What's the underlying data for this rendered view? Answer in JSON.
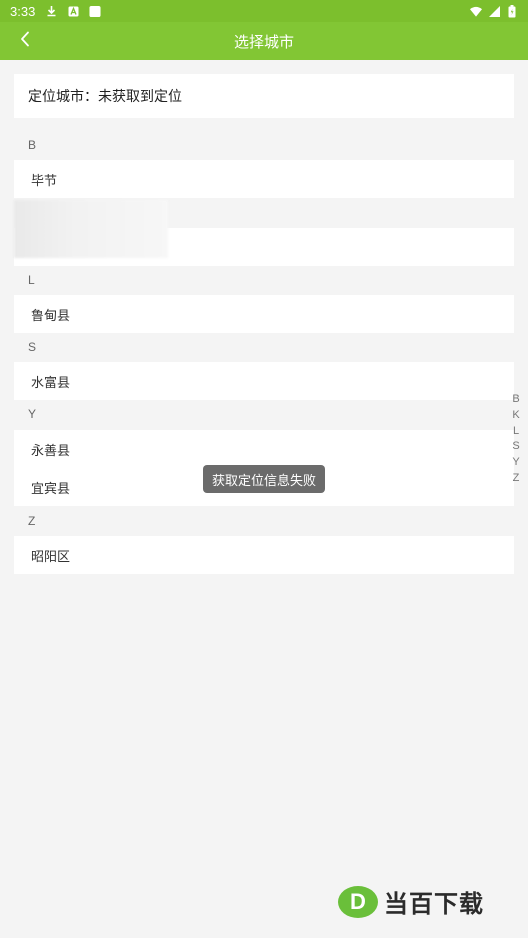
{
  "status_bar": {
    "time": "3:33",
    "icons": [
      "download-icon",
      "a-icon",
      "notification-square-icon",
      "wifi-icon",
      "signal-icon",
      "battery-icon"
    ]
  },
  "app_bar": {
    "title": "选择城市",
    "back_icon": "chevron-left-icon"
  },
  "location": {
    "text": "定位城市：未获取到定位"
  },
  "sections": [
    {
      "letter": "B",
      "items": [
        "毕节"
      ]
    },
    {
      "letter": "L",
      "items": [
        "鲁甸县"
      ]
    },
    {
      "letter": "S",
      "items": [
        "水富县"
      ]
    },
    {
      "letter": "Y",
      "items": [
        "永善县",
        "宜宾县"
      ]
    },
    {
      "letter": "Z",
      "items": [
        "昭阳区"
      ]
    }
  ],
  "index_bar": [
    "B",
    "K",
    "L",
    "S",
    "Y",
    "Z"
  ],
  "toast": "获取定位信息失败",
  "watermark": {
    "logo": "D",
    "text": "当百下载"
  },
  "colors": {
    "accent": "#82c634",
    "status_bar": "#7cbf2d",
    "background": "#f4f4f4",
    "toast": "#6b6b6b"
  }
}
